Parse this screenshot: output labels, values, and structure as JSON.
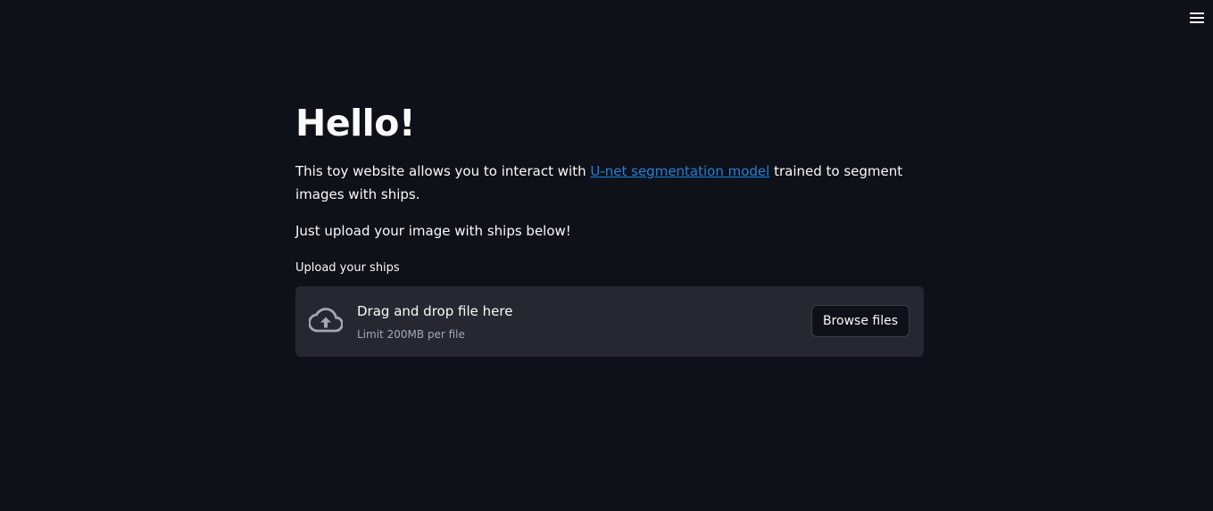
{
  "menu": {
    "icon": "hamburger-menu-icon"
  },
  "main": {
    "title": "Hello!",
    "intro_before": "This toy website allows you to interact with ",
    "intro_link": "U-net segmentation model",
    "intro_after": " trained to segment images with ships.",
    "instruction": "Just upload your image with ships below!"
  },
  "uploader": {
    "label": "Upload your ships",
    "icon": "cloud-upload-icon",
    "drop_text": "Drag and drop file here",
    "limit_text": "Limit 200MB per file",
    "browse_label": "Browse files"
  },
  "colors": {
    "background": "#0e1117",
    "dropzone": "#262730",
    "link": "#1c83e1",
    "text": "#fafafa",
    "muted": "#a3a8b8"
  }
}
